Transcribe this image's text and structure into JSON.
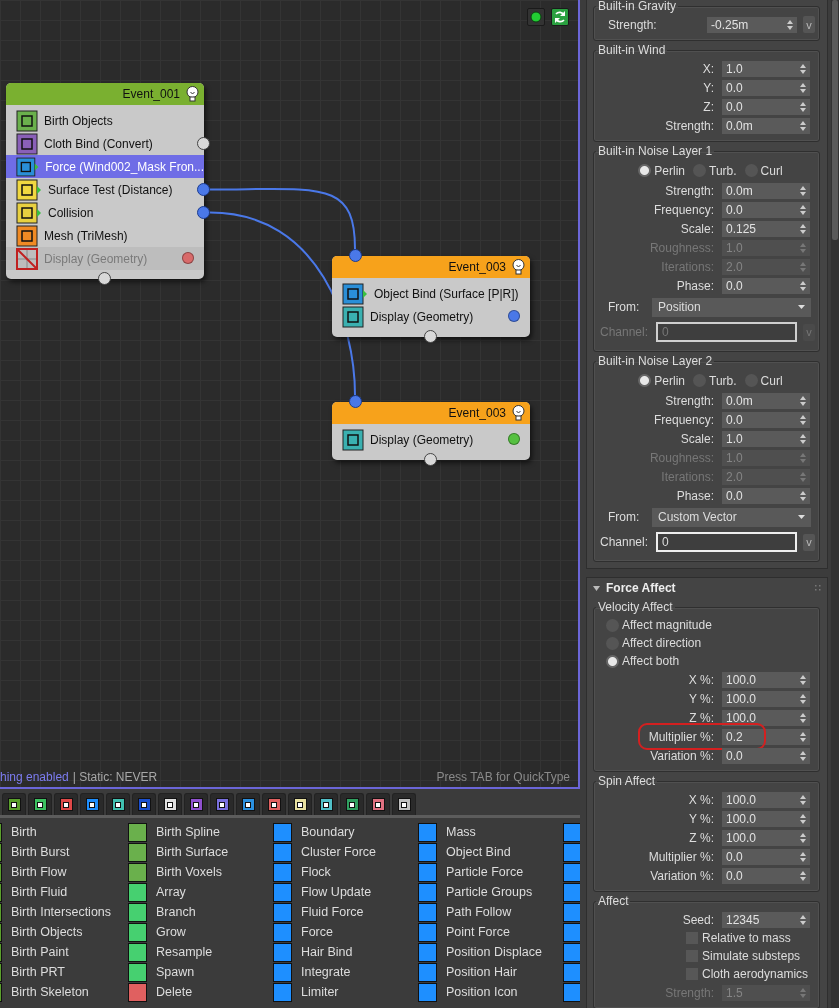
{
  "canvas": {
    "nodes": [
      {
        "title": "Event_001",
        "color": "#7ab030",
        "input_linked": false,
        "items": [
          {
            "label": "Birth Objects",
            "kind": "birth",
            "has_socket": false,
            "selected": false,
            "disabled": false
          },
          {
            "label": "Cloth Bind (Convert)",
            "kind": "cloth",
            "has_socket": true,
            "linked": false,
            "selected": false,
            "disabled": false
          },
          {
            "label": "Force (Wind002_Mask Fron...",
            "kind": "force",
            "has_socket": false,
            "selected": true,
            "disabled": false
          },
          {
            "label": "Surface Test (Distance)",
            "kind": "test",
            "has_socket": true,
            "linked": true,
            "selected": false,
            "disabled": false
          },
          {
            "label": "Collision",
            "kind": "collision",
            "has_socket": true,
            "linked": true,
            "selected": false,
            "disabled": false
          },
          {
            "label": "Mesh (TriMesh)",
            "kind": "mesh",
            "has_socket": false,
            "selected": false,
            "disabled": false
          },
          {
            "label": "Display (Geometry)",
            "kind": "display",
            "color": "#d86a6a",
            "has_socket": false,
            "selected": false,
            "disabled": true
          }
        ]
      },
      {
        "title": "Event_003",
        "color": "#f7a21b",
        "input_linked": true,
        "items": [
          {
            "label": "Object Bind (Surface [P|R])",
            "kind": "bind",
            "has_socket": false,
            "selected": false,
            "disabled": false
          },
          {
            "label": "Display (Geometry)",
            "kind": "display",
            "color": "#4a78e8",
            "has_socket": false,
            "selected": false,
            "disabled": false
          }
        ]
      },
      {
        "title": "Event_003",
        "color": "#f7a21b",
        "input_linked": true,
        "items": [
          {
            "label": "Display (Geometry)",
            "kind": "display",
            "color": "#55c040",
            "has_socket": false,
            "selected": false,
            "disabled": false
          }
        ]
      }
    ],
    "status": {
      "link": "hing enabled",
      "text": "| Static: NEVER",
      "hint": "Press TAB for QuickType"
    }
  },
  "depot": {
    "tabs": [
      {
        "color": "#5aa02c"
      },
      {
        "color": "#3cc060"
      },
      {
        "color": "#e04848"
      },
      {
        "color": "#1e8fff"
      },
      {
        "color": "#40c0b0"
      },
      {
        "color": "#1a4fd0"
      },
      {
        "color": "#e0e0e0"
      },
      {
        "color": "#9050d0"
      },
      {
        "color": "#7a70e0"
      },
      {
        "color": "#2a90e0"
      },
      {
        "color": "#e06060"
      },
      {
        "color": "#e8e0a0"
      },
      {
        "color": "#50c0c8"
      },
      {
        "color": "#30a060"
      },
      {
        "color": "#e07080"
      },
      {
        "color": "#c0c0c0"
      }
    ],
    "columns": [
      [
        {
          "label": "Birth",
          "color": "#5aa02c"
        },
        {
          "label": "Birth Burst",
          "color": "#5aa02c"
        },
        {
          "label": "Birth Flow",
          "color": "#5aa02c"
        },
        {
          "label": "Birth Fluid",
          "color": "#5aa02c"
        },
        {
          "label": "Birth Intersections",
          "color": "#5aa02c"
        },
        {
          "label": "Birth Objects",
          "color": "#5aa02c"
        },
        {
          "label": "Birth Paint",
          "color": "#5aa02c"
        },
        {
          "label": "Birth PRT",
          "color": "#5aa02c"
        },
        {
          "label": "Birth Skeleton",
          "color": "#5aa02c"
        }
      ],
      [
        {
          "label": "Birth Spline",
          "color": "#6ab04c"
        },
        {
          "label": "Birth Surface",
          "color": "#6ab04c"
        },
        {
          "label": "Birth Voxels",
          "color": "#6ab04c"
        },
        {
          "label": "Array",
          "color": "#46d070"
        },
        {
          "label": "Branch",
          "color": "#46d070"
        },
        {
          "label": "Grow",
          "color": "#46d070"
        },
        {
          "label": "Resample",
          "color": "#46d070"
        },
        {
          "label": "Spawn",
          "color": "#46d070"
        },
        {
          "label": "Delete",
          "color": "#e06060"
        }
      ],
      [
        {
          "label": "Boundary",
          "color": "#1e8fff"
        },
        {
          "label": "Cluster Force",
          "color": "#1e8fff"
        },
        {
          "label": "Flock",
          "color": "#1e8fff"
        },
        {
          "label": "Flow Update",
          "color": "#1e8fff"
        },
        {
          "label": "Fluid Force",
          "color": "#1e8fff"
        },
        {
          "label": "Force",
          "color": "#1e8fff"
        },
        {
          "label": "Hair Bind",
          "color": "#1e8fff"
        },
        {
          "label": "Integrate",
          "color": "#1e8fff"
        },
        {
          "label": "Limiter",
          "color": "#1e8fff"
        }
      ],
      [
        {
          "label": "Mass",
          "color": "#1e8fff"
        },
        {
          "label": "Object Bind",
          "color": "#1e8fff"
        },
        {
          "label": "Particle Force",
          "color": "#1e8fff"
        },
        {
          "label": "Particle Groups",
          "color": "#1e8fff"
        },
        {
          "label": "Path Follow",
          "color": "#1e8fff"
        },
        {
          "label": "Point Force",
          "color": "#1e8fff"
        },
        {
          "label": "Position Displace",
          "color": "#1e8fff"
        },
        {
          "label": "Position Hair",
          "color": "#1e8fff"
        },
        {
          "label": "Position Icon",
          "color": "#1e8fff"
        }
      ]
    ],
    "edge_icons": [
      {
        "color": "#1e8fff"
      },
      {
        "color": "#1e8fff"
      },
      {
        "color": "#1e8fff"
      },
      {
        "color": "#1e8fff"
      },
      {
        "color": "#1e8fff"
      },
      {
        "color": "#1e8fff"
      },
      {
        "color": "#1e8fff"
      },
      {
        "color": "#1e8fff"
      },
      {
        "color": "#1e8fff"
      }
    ]
  },
  "panel": {
    "rollouts": [
      {
        "groups": [
          {
            "title": "Built-in Gravity",
            "rows": [
              {
                "kind": "spinner",
                "label": "Strength:",
                "value": "-0.25m",
                "button": "v",
                "disabled": false
              }
            ]
          },
          {
            "title": "Built-in Wind",
            "rows": [
              {
                "kind": "spinner",
                "label": "X:",
                "value": "1.0",
                "disabled": false
              },
              {
                "kind": "spinner",
                "label": "Y:",
                "value": "0.0",
                "disabled": false
              },
              {
                "kind": "spinner",
                "label": "Z:",
                "value": "0.0",
                "disabled": false
              },
              {
                "kind": "spinner",
                "label": "Strength:",
                "value": "0.0m",
                "disabled": false
              }
            ]
          },
          {
            "title": "Built-in Noise Layer 1",
            "rows": [
              {
                "kind": "radio_row",
                "options": [
                  {
                    "label": "Perlin",
                    "selected": true
                  },
                  {
                    "label": "Turb.",
                    "selected": false
                  },
                  {
                    "label": "Curl",
                    "selected": false
                  }
                ]
              },
              {
                "kind": "spinner",
                "label": "Strength:",
                "value": "0.0m",
                "disabled": false
              },
              {
                "kind": "spinner",
                "label": "Frequency:",
                "value": "0.0",
                "disabled": false
              },
              {
                "kind": "spinner",
                "label": "Scale:",
                "value": "0.125",
                "disabled": false
              },
              {
                "kind": "spinner",
                "label": "Roughness:",
                "value": "1.0",
                "disabled": true
              },
              {
                "kind": "spinner",
                "label": "Iterations:",
                "value": "2.0",
                "disabled": true
              },
              {
                "kind": "spinner",
                "label": "Phase:",
                "value": "0.0",
                "disabled": false
              },
              {
                "kind": "dropdown",
                "label": "From:",
                "value": "Position"
              },
              {
                "kind": "channel",
                "label": "Channel:",
                "value": "0",
                "button": "v",
                "disabled": true
              }
            ]
          },
          {
            "title": "Built-in Noise Layer 2",
            "rows": [
              {
                "kind": "radio_row",
                "options": [
                  {
                    "label": "Perlin",
                    "selected": true
                  },
                  {
                    "label": "Turb.",
                    "selected": false
                  },
                  {
                    "label": "Curl",
                    "selected": false
                  }
                ]
              },
              {
                "kind": "spinner",
                "label": "Strength:",
                "value": "0.0m",
                "disabled": false
              },
              {
                "kind": "spinner",
                "label": "Frequency:",
                "value": "0.0",
                "disabled": false
              },
              {
                "kind": "spinner",
                "label": "Scale:",
                "value": "1.0",
                "disabled": false
              },
              {
                "kind": "spinner",
                "label": "Roughness:",
                "value": "1.0",
                "disabled": true
              },
              {
                "kind": "spinner",
                "label": "Iterations:",
                "value": "2.0",
                "disabled": true
              },
              {
                "kind": "spinner",
                "label": "Phase:",
                "value": "0.0",
                "disabled": false
              },
              {
                "kind": "dropdown",
                "label": "From:",
                "value": "Custom Vector"
              },
              {
                "kind": "channel",
                "label": "Channel:",
                "value": "0",
                "button": "v",
                "disabled": false
              }
            ]
          }
        ]
      },
      {
        "title": "Force Affect",
        "expanded": true,
        "groups": [
          {
            "title": "Velocity Affect",
            "rows": [
              {
                "kind": "radio_list",
                "options": [
                  {
                    "label": "Affect magnitude",
                    "selected": false
                  },
                  {
                    "label": "Affect direction",
                    "selected": false
                  },
                  {
                    "label": "Affect both",
                    "selected": true
                  }
                ]
              },
              {
                "kind": "spinner",
                "label": "X %:",
                "value": "100.0",
                "disabled": false,
                "highlighted": false
              },
              {
                "kind": "spinner",
                "label": "Y %:",
                "value": "100.0",
                "disabled": false,
                "highlighted": false
              },
              {
                "kind": "spinner",
                "label": "Z %:",
                "value": "100.0",
                "disabled": false,
                "highlighted": false
              },
              {
                "kind": "spinner",
                "label": "Multiplier %:",
                "value": "0.2",
                "disabled": false,
                "highlighted": true
              },
              {
                "kind": "spinner",
                "label": "Variation %:",
                "value": "0.0",
                "disabled": false,
                "highlighted": false
              }
            ]
          },
          {
            "title": "Spin Affect",
            "rows": [
              {
                "kind": "spinner",
                "label": "X %:",
                "value": "100.0",
                "disabled": false
              },
              {
                "kind": "spinner",
                "label": "Y %:",
                "value": "100.0",
                "disabled": false
              },
              {
                "kind": "spinner",
                "label": "Z %:",
                "value": "100.0",
                "disabled": false
              },
              {
                "kind": "spinner",
                "label": "Multiplier %:",
                "value": "0.0",
                "disabled": false
              },
              {
                "kind": "spinner",
                "label": "Variation %:",
                "value": "0.0",
                "disabled": false
              }
            ]
          },
          {
            "title": "Affect",
            "rows": [
              {
                "kind": "spinner",
                "label": "Seed:",
                "value": "12345",
                "disabled": false
              },
              {
                "kind": "checkbox",
                "label": "Relative to mass",
                "checked": false
              },
              {
                "kind": "checkbox",
                "label": "Simulate substeps",
                "checked": false
              },
              {
                "kind": "checkbox",
                "label": "Cloth aerodynamics",
                "checked": false
              },
              {
                "kind": "spinner",
                "label": "Strength:",
                "value": "1.5",
                "disabled": true
              }
            ]
          }
        ]
      }
    ]
  }
}
